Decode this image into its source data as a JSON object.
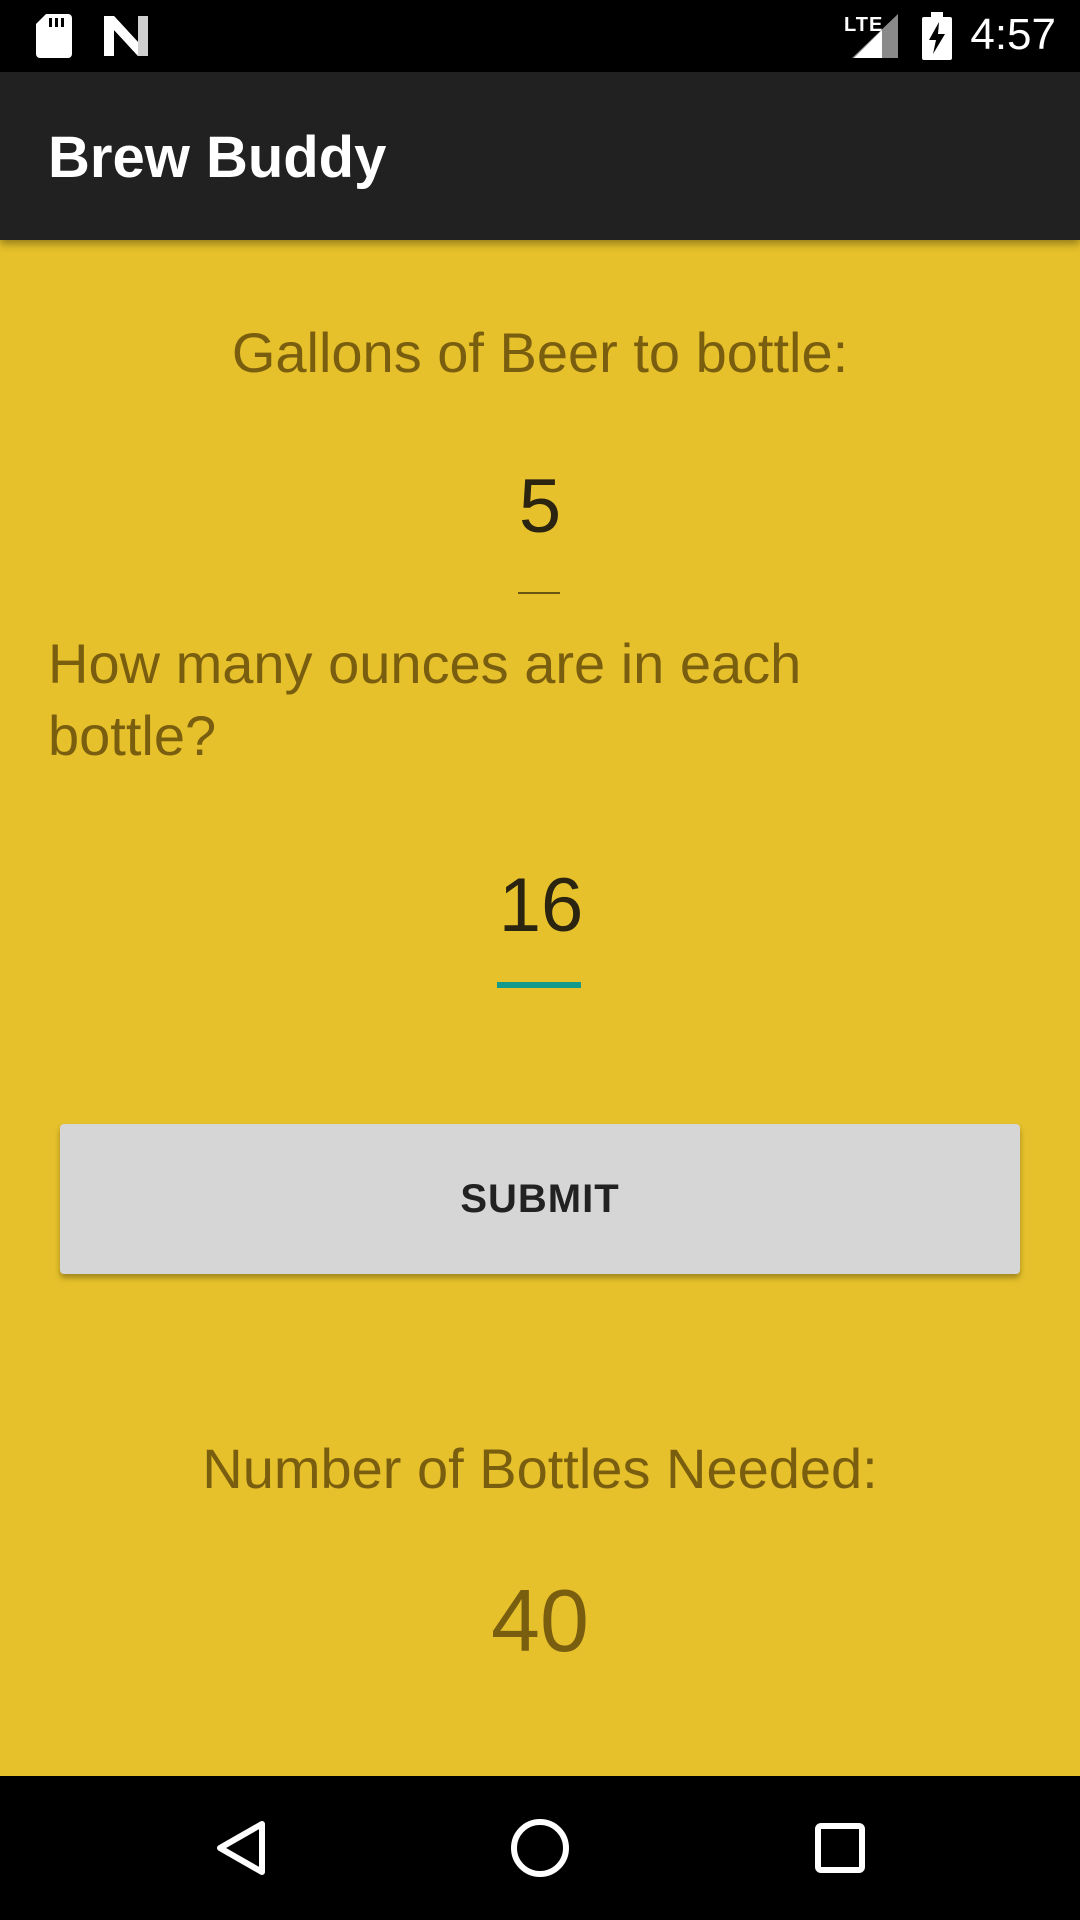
{
  "status_bar": {
    "network": "LTE",
    "time": "4:57",
    "icons": [
      "sd-card-icon",
      "n-icon",
      "signal-icon",
      "battery-charging-icon"
    ]
  },
  "app_bar": {
    "title": "Brew Buddy"
  },
  "form": {
    "gallons_label": "Gallons of Beer to bottle:",
    "gallons_value": "5",
    "ounces_label": "How many ounces are in each bottle?",
    "ounces_value": "16",
    "submit_label": "SUBMIT"
  },
  "result": {
    "label": "Number of Bottles Needed:",
    "value": "40"
  },
  "nav_bar": {
    "icons": [
      "back-icon",
      "home-icon",
      "recents-icon"
    ]
  },
  "colors": {
    "background": "#E6C12B",
    "app_bar": "#212121",
    "accent": "#139A8A",
    "label_text": "#7A5E10",
    "button": "#D6D6D6"
  }
}
